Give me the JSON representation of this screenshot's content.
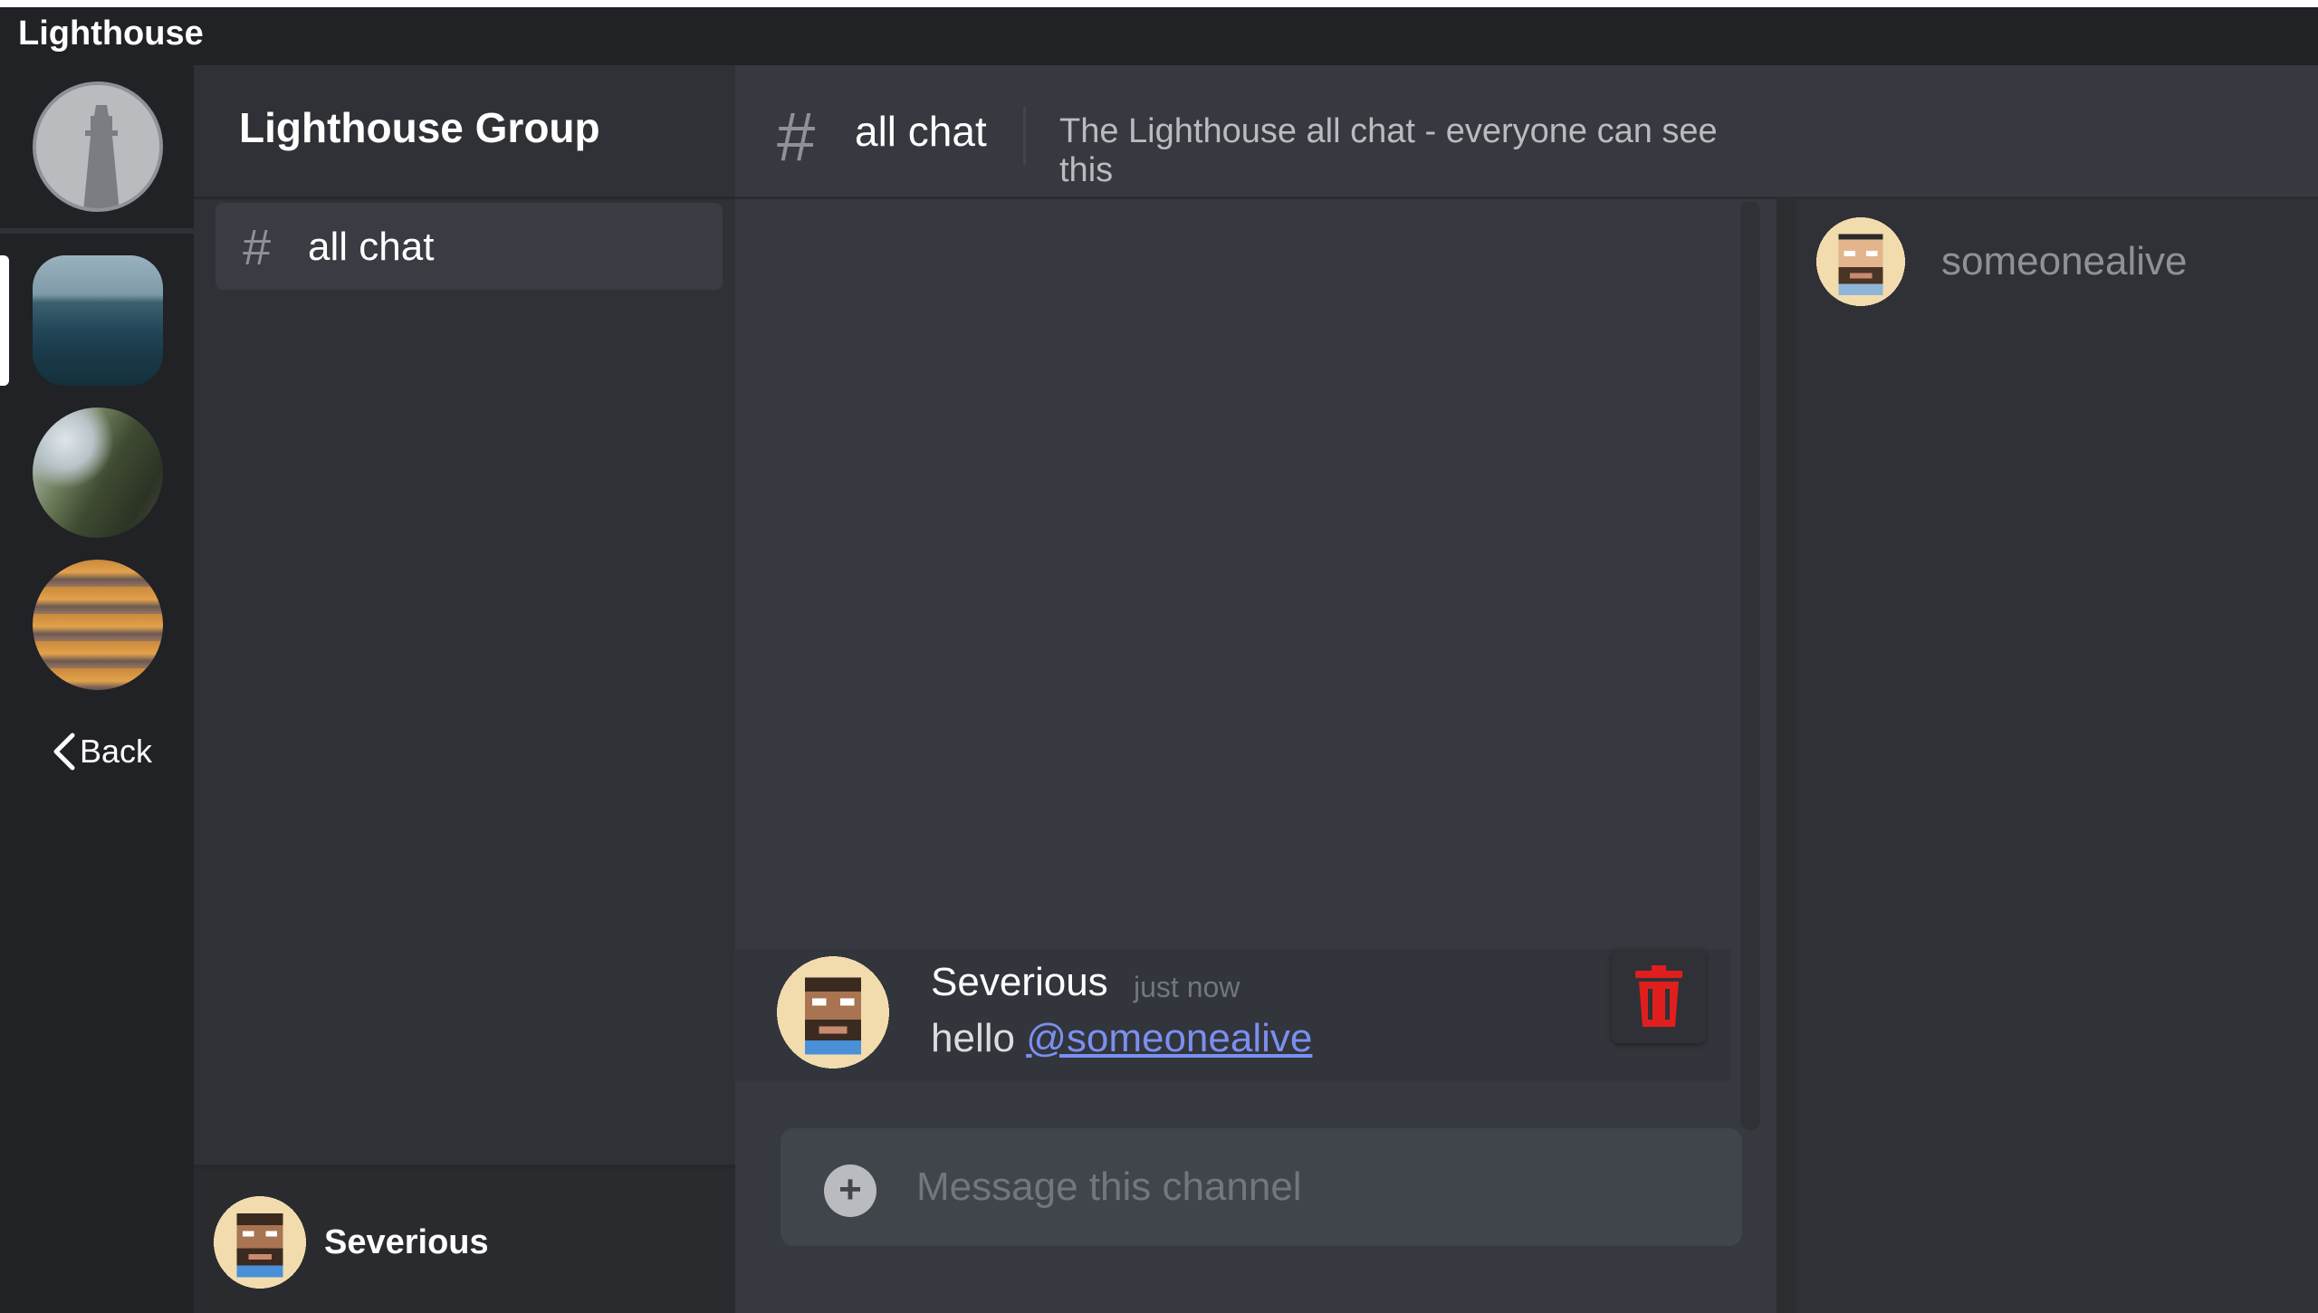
{
  "app": {
    "title": "Lighthouse"
  },
  "rail": {
    "back_label": "Back"
  },
  "guild": {
    "name": "Lighthouse Group",
    "channels": [
      {
        "label": "all chat"
      }
    ]
  },
  "current_user": {
    "name": "Severious"
  },
  "chat": {
    "channel_name": "all chat",
    "topic": "The Lighthouse all chat - everyone can see this",
    "messages": [
      {
        "author": "Severious",
        "timestamp": "just now",
        "text": "hello ",
        "mention": "@someonealive"
      }
    ],
    "composer_placeholder": "Message this channel",
    "composer_plus": "+"
  },
  "members": [
    {
      "name": "someonealive"
    }
  ],
  "colors": {
    "background": "#36393f",
    "sidebar": "#2f3136",
    "rail": "#202225",
    "mention": "#7b8ff0",
    "delete": "#e01e1e"
  }
}
